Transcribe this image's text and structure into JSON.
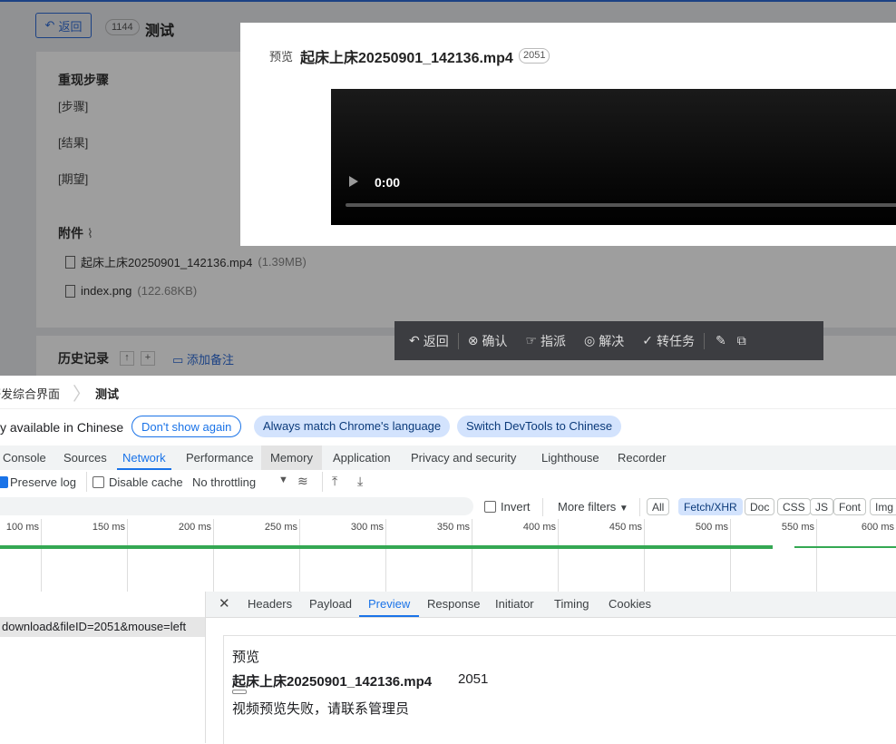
{
  "app": {
    "back_label": "返回",
    "issue_id": "1144",
    "title": "测试",
    "repro_heading": "重现步骤",
    "steps": [
      "[步骤]",
      "[结果]",
      "[期望]"
    ],
    "attachments_heading": "附件",
    "attachments": [
      {
        "name": "起床上床20250901_142136.mp4",
        "size": "(1.39MB)"
      },
      {
        "name": "index.png",
        "size": "(122.68KB)"
      }
    ],
    "history_heading": "历史记录",
    "add_note": "添加备注"
  },
  "modal": {
    "label": "预览",
    "file_name": "起床上床20250901_142136.mp4",
    "file_id": "2051",
    "video_time": "0:00"
  },
  "toolbar": {
    "back": "返回",
    "confirm": "确认",
    "assign": "指派",
    "resolve": "解决",
    "to_task": "转任务"
  },
  "devtools": {
    "breadcrumb": [
      "研发综合界面",
      "测试"
    ],
    "infobar_text": "y available in Chinese",
    "dont_show": "Don't show again",
    "always_match": "Always match Chrome's language",
    "switch_lang": "Switch DevTools to Chinese",
    "tabs": [
      "Console",
      "Sources",
      "Network",
      "Performance",
      "Memory",
      "Application",
      "Privacy and security",
      "Lighthouse",
      "Recorder"
    ],
    "preserve_log": "Preserve log",
    "disable_cache": "Disable cache",
    "throttling": "No throttling",
    "invert": "Invert",
    "more_filters": "More filters",
    "filter_chips": [
      "All",
      "Fetch/XHR",
      "Doc",
      "CSS",
      "JS",
      "Font",
      "Img"
    ],
    "ticks": [
      "100 ms",
      "150 ms",
      "200 ms",
      "250 ms",
      "300 ms",
      "350 ms",
      "400 ms",
      "450 ms",
      "500 ms",
      "550 ms",
      "600 ms"
    ],
    "request": "download&fileID=2051&mouse=left",
    "panel_tabs": [
      "Headers",
      "Payload",
      "Preview",
      "Response",
      "Initiator",
      "Timing",
      "Cookies"
    ],
    "preview": {
      "label": "预览",
      "file_name": "起床上床20250901_142136.mp4",
      "file_id": "2051",
      "error": "视频预览失败，请联系管理员"
    }
  }
}
